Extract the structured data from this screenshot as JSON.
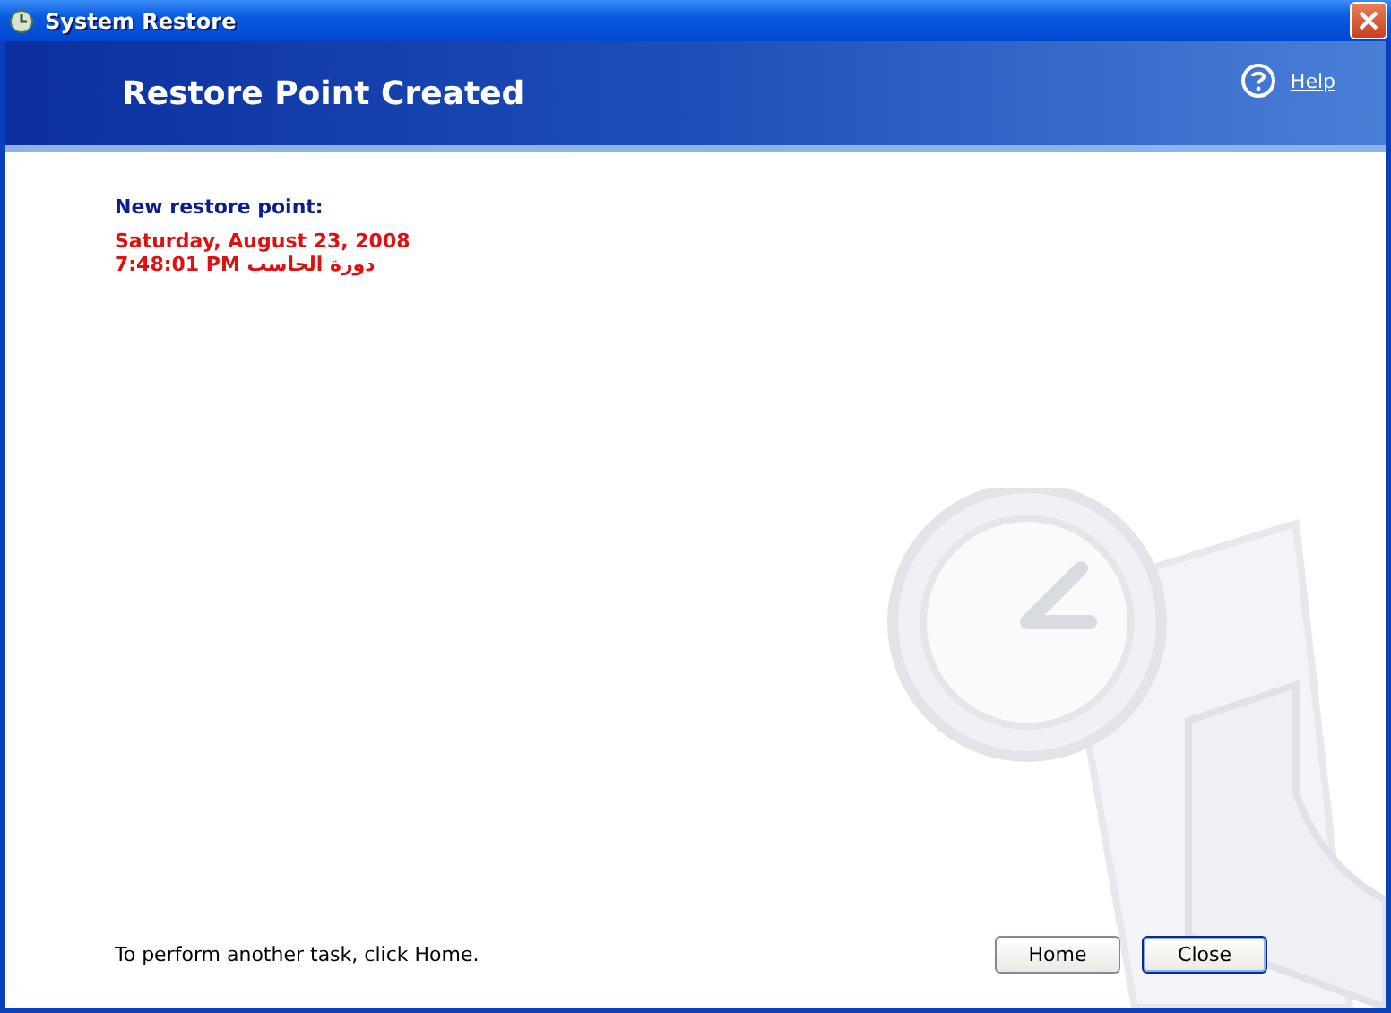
{
  "window": {
    "title": "System Restore"
  },
  "header": {
    "title": "Restore Point Created",
    "help_link": "Help"
  },
  "restore_point": {
    "label": "New restore point:",
    "date": "Saturday, August 23, 2008",
    "time_and_name": "7:48:01 PM  دورة الحاسب"
  },
  "footer": {
    "hint": "To perform another task, click Home.",
    "buttons": [
      {
        "label": "Home",
        "focused": false
      },
      {
        "label": "Close",
        "focused": true
      }
    ]
  }
}
